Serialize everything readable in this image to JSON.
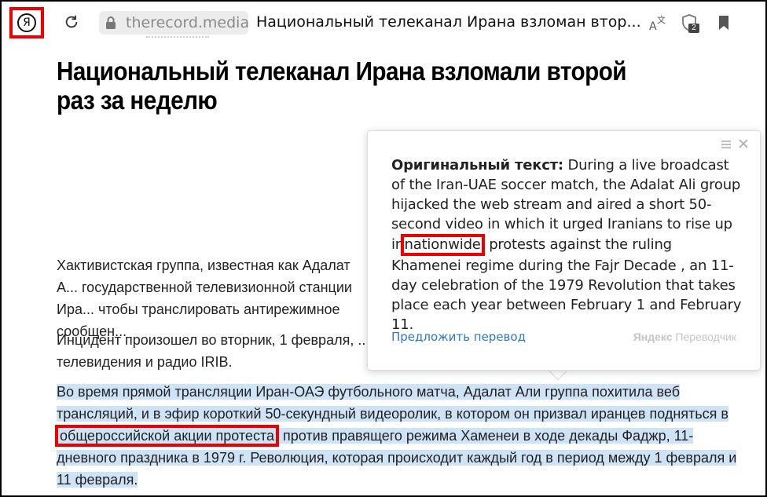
{
  "browser": {
    "logo_letter": "Я",
    "domain": "therecord.media",
    "tab_title": "Национальный телеканал Ирана взломан втор...",
    "shield_count": "2"
  },
  "article": {
    "headline": "Национальный телеканал Ирана взломали второй раз за неделю",
    "p1_text": "Хактивистская группа, известная как Адалат А... государственной телевизионной станции Ира... чтобы транслировать антирежимное сообщен...",
    "p2_text": "Инцидент произошел во вторник, 1 февраля, ... телевидения и радио IRIB.",
    "p3_before": "Во время прямой трансляции Иран-ОАЭ футбольного матча, Адалат Али группа похитила веб трансляций, и в эфир короткий 50-секундный видеоролик, в котором он призвал иранцев подняться в ",
    "p3_boxed": "общероссийской акции протеста",
    "p3_after": " против правящего режима Хаменеи в ходе декады Фаджр, 11-дневного праздника в 1979 г. Революция, которая происходит каждый год в период между 1 февраля и 11 февраля."
  },
  "popup": {
    "label": "Оригинальный текст:",
    "text_before": " During a live broadcast of the Iran-UAE soccer match, the Adalat Ali group hijacked the web stream and aired a short 50-second video in which it urged Iranians to rise up in ",
    "text_boxed": "nationwide",
    "text_after": " protests against the ruling Khamenei regime during the  Fajr Decade , an 11-day celebration of the 1979 Revolution that takes place each year between February 1 and February 11.",
    "suggest_link": "Предложить перевод",
    "brand_bold": "Яндекс",
    "brand_rest": " Переводчик"
  },
  "colors": {
    "highlight": "#cfe3f7",
    "annotation_red": "#e00000",
    "link_blue": "#2f76c9"
  }
}
